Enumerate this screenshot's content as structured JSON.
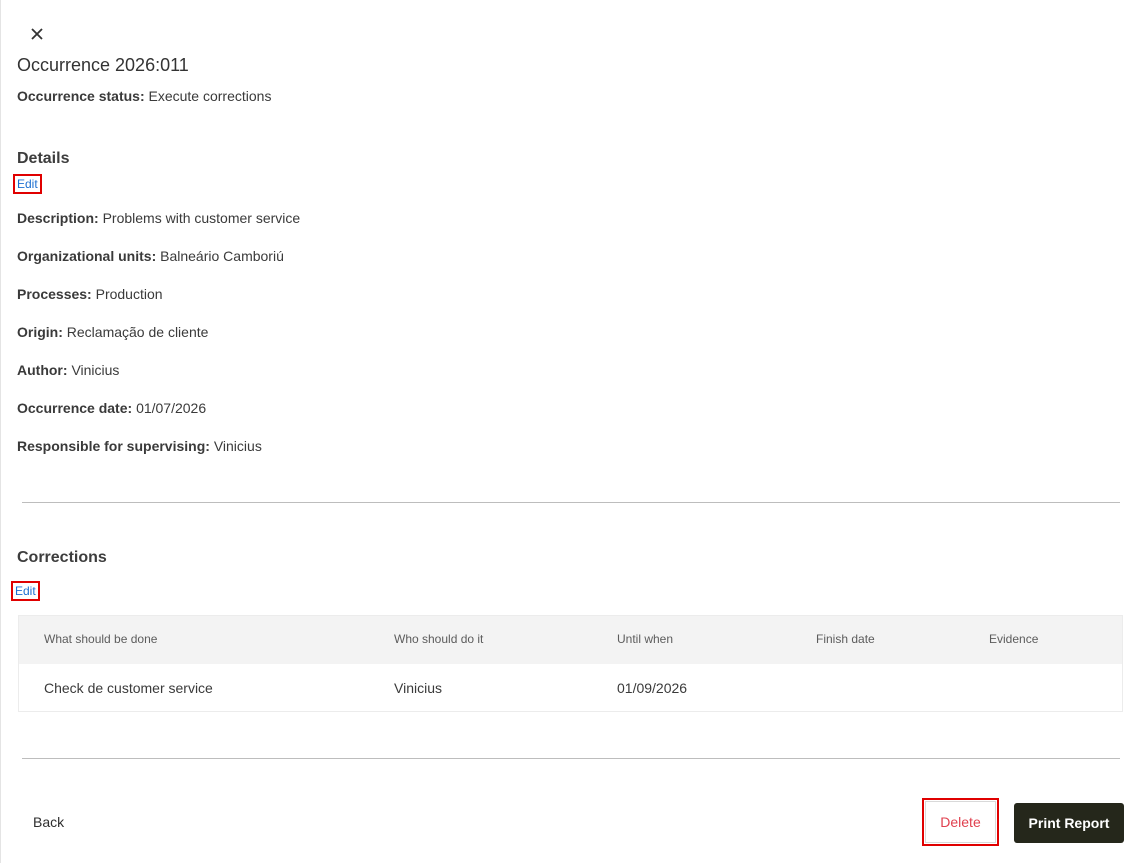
{
  "header": {
    "title": "Occurrence 2026:011",
    "status_label": "Occurrence status:",
    "status_value": "Execute corrections"
  },
  "details": {
    "title": "Details",
    "edit_label": "Edit",
    "fields": [
      {
        "label": "Description:",
        "value": "Problems with customer service"
      },
      {
        "label": "Organizational units:",
        "value": "Balneário Camboriú"
      },
      {
        "label": "Processes:",
        "value": "Production"
      },
      {
        "label": "Origin:",
        "value": "Reclamação de cliente"
      },
      {
        "label": "Author:",
        "value": "Vinicius"
      },
      {
        "label": "Occurrence date:",
        "value": "01/07/2026"
      },
      {
        "label": "Responsible for supervising:",
        "value": "Vinicius"
      }
    ]
  },
  "corrections": {
    "title": "Corrections",
    "edit_label": "Edit",
    "columns": [
      "What should be done",
      "Who should do it",
      "Until when",
      "Finish date",
      "Evidence"
    ],
    "rows": [
      [
        "Check de customer service",
        "Vinicius",
        "01/09/2026",
        "",
        ""
      ]
    ]
  },
  "footer": {
    "back_label": "Back",
    "delete_label": "Delete",
    "print_label": "Print Report"
  },
  "colors": {
    "primary_button": "#25271b",
    "delete_text": "#e0414f",
    "link": "#1c6fd1",
    "highlight_box": "#e00000"
  },
  "icons": {
    "close": "close-icon"
  }
}
